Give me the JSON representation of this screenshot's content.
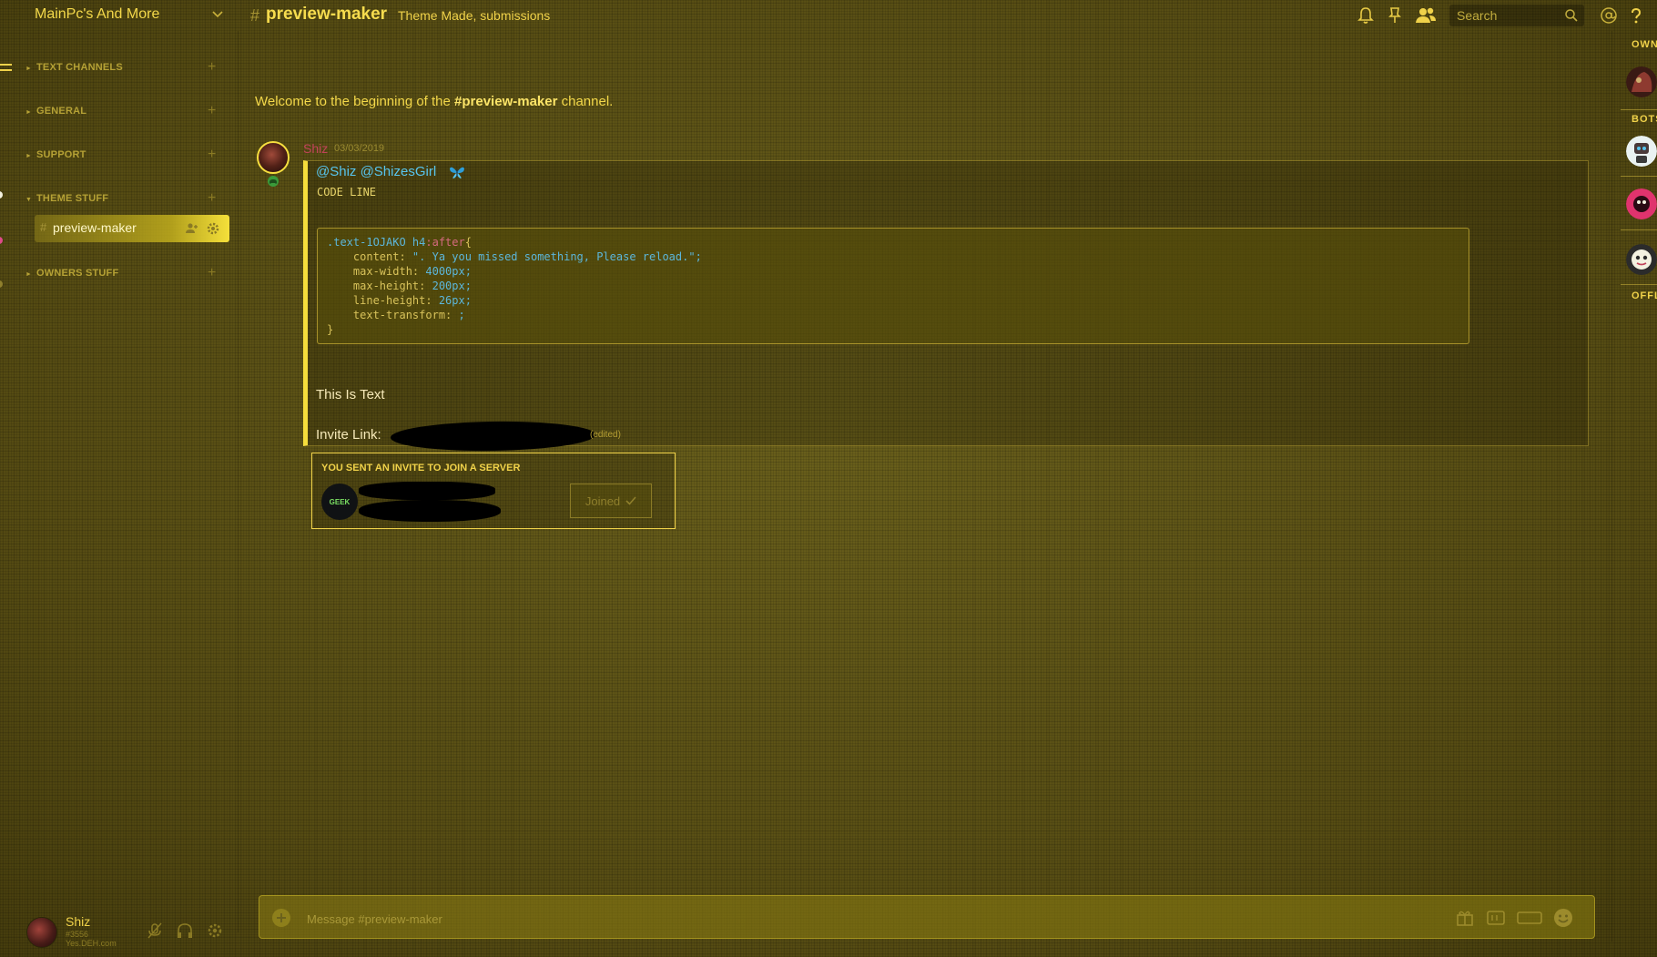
{
  "guild": {
    "name": "MainPc's And More"
  },
  "channel": {
    "hash": "#",
    "name": "preview-maker",
    "topic": "Theme Made, submissions"
  },
  "header": {
    "search_placeholder": "Search"
  },
  "sidebar": {
    "categories": [
      {
        "label": "TEXT CHANNELS"
      },
      {
        "label": "GENERAL"
      },
      {
        "label": "SUPPORT"
      },
      {
        "label": "THEME STUFF"
      },
      {
        "label": "OWNERS STUFF"
      }
    ],
    "active_channel": {
      "hash": "#",
      "label": "preview-maker"
    }
  },
  "user": {
    "name": "Shiz",
    "discriminator": "#3556",
    "subtext": "Yes.DEH.com"
  },
  "chat": {
    "welcome_prefix": "Welcome to the beginning of the ",
    "welcome_channel": "#preview-maker",
    "welcome_suffix": " channel.",
    "message": {
      "author": "Shiz",
      "timestamp": "03/03/2019",
      "mentions": "@Shiz @ShizesGirl",
      "code_line": "CODE LINE",
      "code": {
        "selector": ".text-1OJAKO h4",
        "pseudo": ":after",
        "open": "{",
        "line1_prop": "    content: ",
        "line1_val": "\". Ya you missed something, Please reload.\";",
        "line2_prop": "    max-width: ",
        "line2_val": "4000px;",
        "line3_prop": "    max-height: ",
        "line3_val": "200px;",
        "line4_prop": "    line-height: ",
        "line4_val": "26px;",
        "line5_prop": "    text-transform: ",
        "line5_val": ";",
        "close": "}"
      },
      "text": "This Is Text",
      "invite_label": "Invite Link:",
      "edited_tail": "(edited)"
    },
    "invite": {
      "title": "YOU SENT AN INVITE TO JOIN A SERVER",
      "server_icon_text": "GEEK",
      "joined_label": "Joined"
    }
  },
  "composer": {
    "placeholder": "Message #preview-maker"
  },
  "members": {
    "sections": [
      "OWN",
      "BOTS",
      "OFFL"
    ]
  },
  "colors": {
    "accent": "#f0d24a",
    "mention": "#58c5ee",
    "author": "#c0435a",
    "bot_badge": "#e0336e"
  }
}
